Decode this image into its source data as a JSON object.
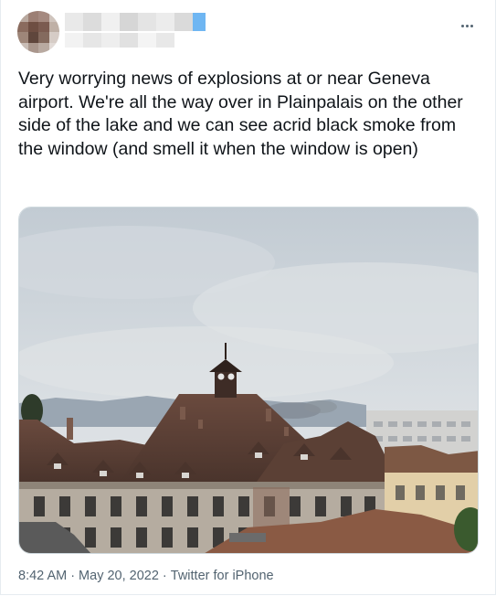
{
  "tweet": {
    "text": "Very worrying news of explosions at or near Geneva airport. We're all the way over in Plainpalais on the other side of the lake and we can see acrid black smoke from the window (and smell it when the window is open)",
    "time": "8:42 AM",
    "date": "May 20, 2022",
    "source": "Twitter for iPhone",
    "separator": "·",
    "more_icon": "more-horizontal-icon"
  },
  "colors": {
    "text": "#0f1419",
    "secondary": "#536471",
    "border": "#cfd9de"
  }
}
